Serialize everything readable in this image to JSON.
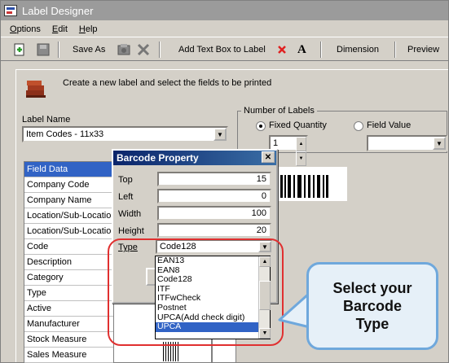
{
  "window": {
    "title": "Label Designer"
  },
  "menu": [
    {
      "label": "Options",
      "mnemonic": "O",
      "rest": "ptions"
    },
    {
      "label": "Edit",
      "mnemonic": "E",
      "rest": "dit"
    },
    {
      "label": "Help",
      "mnemonic": "H",
      "rest": "elp"
    }
  ],
  "toolbar": {
    "save_as": "Save As",
    "add_text_box": "Add Text Box to Label",
    "dimension": "Dimension",
    "preview": "Preview",
    "icons": [
      "new-icon",
      "save-icon",
      "settings-icon",
      "delete-icon",
      "remove-red-x-icon",
      "font-icon"
    ]
  },
  "instruction": "Create a new label and select the fields to be printed",
  "label_name": {
    "label": "Label Name",
    "value": "Item Codes - 11x33"
  },
  "number_of_labels": {
    "title": "Number of Labels",
    "fixed_quantity": "Fixed Quantity",
    "field_value": "Field Value",
    "quantity": "1",
    "selected": "fixed_quantity"
  },
  "fields_grid": {
    "rows": [
      "Field Data",
      "Company Code",
      "Company Name",
      "Location/Sub-Location",
      "Location/Sub-Location",
      "Code",
      "Description",
      "Category",
      "Type",
      "Active",
      "Manufacturer",
      "Stock Measure",
      "Sales Measure"
    ],
    "selected_index": 0
  },
  "barcode_dialog": {
    "title": "Barcode Property",
    "close": "✕",
    "fields": [
      {
        "label": "Top",
        "value": "15"
      },
      {
        "label": "Left",
        "value": "0"
      },
      {
        "label": "Width",
        "value": "100"
      },
      {
        "label": "Height",
        "value": "20"
      }
    ],
    "type_label": "Type",
    "type_value": "Code128"
  },
  "type_dropdown": {
    "options": [
      "EAN13",
      "EAN8",
      "Code128",
      "ITF",
      "ITFwCheck",
      "Postnet",
      "UPCA(Add check digit)",
      "UPCA"
    ],
    "selected": "UPCA"
  },
  "callout": {
    "text": "Select your\nBarcode\nType"
  },
  "colors": {
    "highlight": "#e03030",
    "callout_border": "#6fa8dc",
    "selection": "#3163c5"
  }
}
